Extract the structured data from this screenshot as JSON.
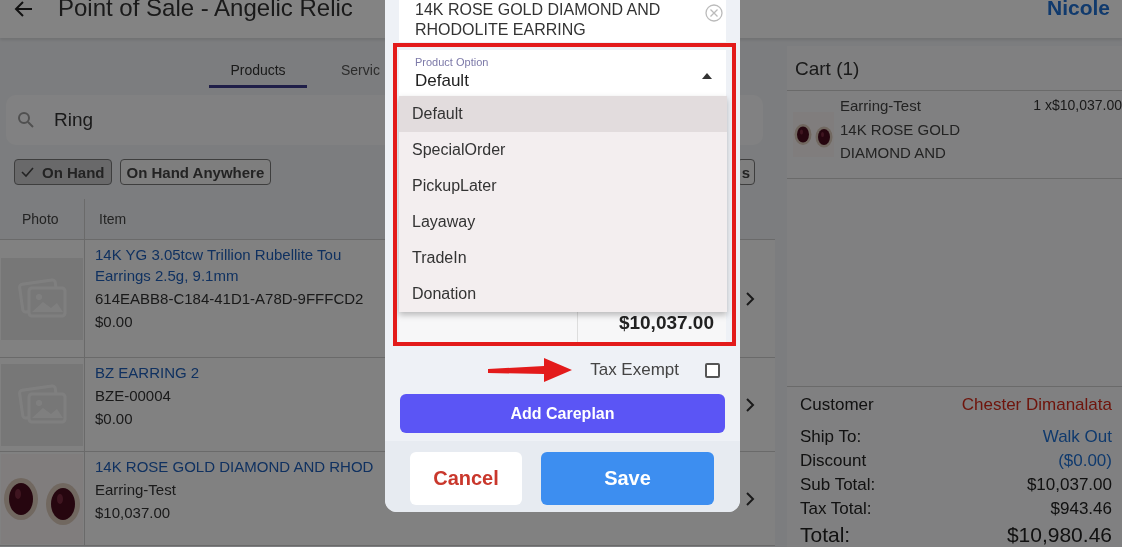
{
  "header": {
    "title": "Point of Sale - Angelic Relic",
    "user": "Nicole"
  },
  "tabs": [
    {
      "label": "Products",
      "selected": true
    },
    {
      "label": "Servic",
      "selected": false
    }
  ],
  "search": {
    "value": "Ring"
  },
  "filters": [
    {
      "label": "On Hand",
      "checked": true
    },
    {
      "label": "On Hand Anywhere",
      "checked": false
    },
    {
      "label": "s",
      "checked": false
    }
  ],
  "table": {
    "columns": [
      "Photo",
      "Item"
    ],
    "rows": [
      {
        "kind": "placeholder",
        "name_lines": [
          "14K YG 3.05tcw Trillion Rubellite Tou",
          "Earrings 2.5g, 9.1mm"
        ],
        "code": "614EABB8-C184-41D1-A78D-9FFFCD2",
        "price": "$0.00"
      },
      {
        "kind": "placeholder",
        "name_lines": [
          "BZ EARRING 2"
        ],
        "code": "BZE-00004",
        "price": "$0.00"
      },
      {
        "kind": "picture",
        "name_lines": [
          "14K ROSE GOLD DIAMOND AND RHOD"
        ],
        "code": "Earring-Test",
        "price": "$10,037.00"
      }
    ]
  },
  "cart": {
    "title": "Cart (1)",
    "items": [
      {
        "sku": "Earring-Test",
        "qty_price": "1 x$10,037.00",
        "name": "14K ROSE GOLD DIAMOND AND"
      }
    ],
    "summary": [
      {
        "label": "Customer",
        "value": "Chester Dimanalata",
        "kind": "customer"
      },
      {
        "label": "Ship To:",
        "value": "Walk Out",
        "kind": "link"
      },
      {
        "label": "Discount",
        "value": "($0.00)",
        "kind": "link"
      },
      {
        "label": "Sub Total:",
        "value": "$10,037.00",
        "kind": "plain"
      },
      {
        "label": "Tax Total:",
        "value": "$943.46",
        "kind": "plain"
      },
      {
        "label": "Total:",
        "value": "$10,980.46",
        "kind": "total"
      }
    ]
  },
  "dialog": {
    "product_name": "14K ROSE GOLD DIAMOND AND RHODOLITE EARRING",
    "product_option": {
      "label": "Product Option",
      "value": "Default",
      "expanded": true,
      "options": [
        {
          "label": "Default",
          "selected": true
        },
        {
          "label": "SpecialOrder",
          "selected": false
        },
        {
          "label": "PickupLater",
          "selected": false
        },
        {
          "label": "Layaway",
          "selected": false
        },
        {
          "label": "TradeIn",
          "selected": false
        },
        {
          "label": "Donation",
          "selected": false
        }
      ]
    },
    "line_price": "$10,037.00",
    "tax_exempt": {
      "label": "Tax Exempt",
      "checked": false
    },
    "buttons": [
      {
        "label": "Add Careplan",
        "kind": "careplan"
      },
      {
        "label": "Cancel",
        "kind": "cancel"
      },
      {
        "label": "Save",
        "kind": "save"
      }
    ]
  }
}
